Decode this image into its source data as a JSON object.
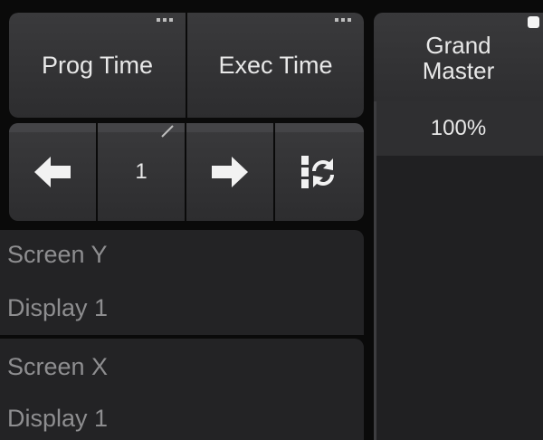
{
  "buttons": {
    "prog_time": "Prog Time",
    "exec_time": "Exec Time"
  },
  "pager": {
    "page_number": "1"
  },
  "screen_y": {
    "title": "Screen Y",
    "display": "Display 1"
  },
  "screen_x": {
    "title": "Screen X",
    "display": "Display 1"
  },
  "grand_master": {
    "title_line1": "Grand",
    "title_line2": "Master",
    "value": "100%"
  },
  "icons": {
    "left": "arrow-left-icon",
    "right": "arrow-right-icon",
    "cycle": "cycle-refresh-icon",
    "edit": "pencil-icon",
    "more": "ellipsis-icon"
  }
}
